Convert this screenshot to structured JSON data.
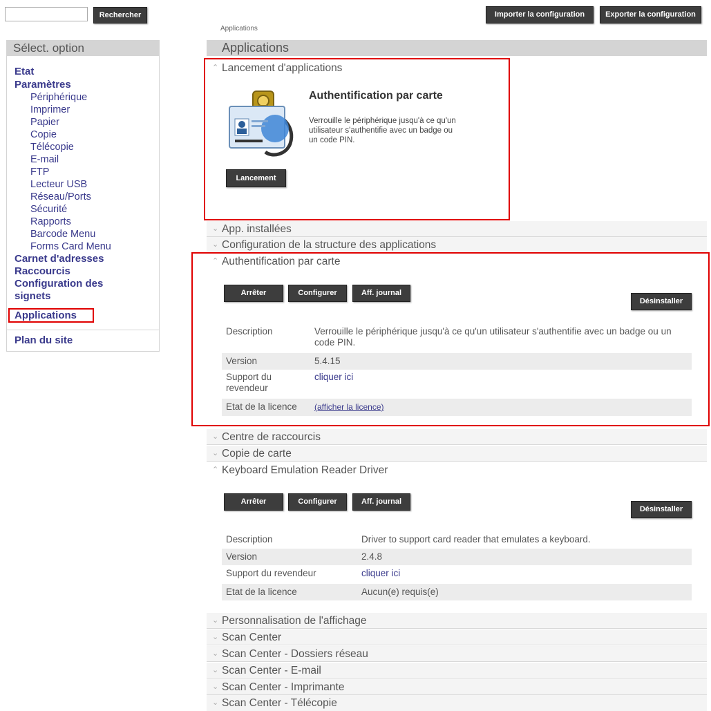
{
  "search": {
    "placeholder": "",
    "button_label": "Rechercher"
  },
  "left_nav": {
    "header": "Sélect. option",
    "etat": "Etat",
    "parametres": "Paramètres",
    "sub_items": [
      "Périphérique",
      "Imprimer",
      "Papier",
      "Copie",
      "Télécopie",
      "E-mail",
      "FTP",
      "Lecteur USB",
      "Réseau/Ports",
      "Sécurité",
      "Rapports",
      "Barcode Menu",
      "Forms Card Menu"
    ],
    "carnet": "Carnet d'adresses",
    "raccourcis": "Raccourcis",
    "config_signets_1": "Configuration des",
    "config_signets_2": "signets",
    "applications": "Applications",
    "plan_du_site": "Plan du site"
  },
  "toolbar": {
    "import_label": "Importer la configuration",
    "export_label": "Exporter la configuration"
  },
  "breadcrumb": "Applications",
  "main": {
    "title": "Applications",
    "launch_section": {
      "label": "Lancement d'applications",
      "app_title": "Authentification par carte",
      "app_desc": "Verrouille le périphérique jusqu'à ce qu'un utilisateur s'authentifie avec un badge ou un code PIN.",
      "launch_button": "Lancement"
    },
    "installed_label": "App. installées",
    "framework_label": "Configuration de la structure des applications",
    "card_auth": {
      "label": "Authentification par carte",
      "stop": "Arrêter",
      "configure": "Configurer",
      "log": "Aff. journal",
      "uninstall": "Désinstaller",
      "desc_key": "Description",
      "desc_val": "Verrouille le périphérique jusqu'à ce qu'un utilisateur s'authentifie avec un badge ou un code PIN.",
      "version_key": "Version",
      "version_val": "5.4.15",
      "support_key": "Support du revendeur",
      "support_val": "cliquer ici",
      "license_key": "Etat de la licence",
      "license_val": "(afficher la licence)"
    },
    "shortcut_center": "Centre de raccourcis",
    "card_copy": "Copie de carte",
    "keyboard_driver": {
      "label": "Keyboard Emulation Reader Driver",
      "stop": "Arrêter",
      "configure": "Configurer",
      "log": "Aff. journal",
      "uninstall": "Désinstaller",
      "desc_key": "Description",
      "desc_val": "Driver to support card reader that emulates a keyboard.",
      "version_key": "Version",
      "version_val": "2.4.8",
      "support_key": "Support du revendeur",
      "support_val": "cliquer ici",
      "license_key": "Etat de la licence",
      "license_val": "Aucun(e) requis(e)"
    },
    "bottom_sections": [
      "Personnalisation de l'affichage",
      "Scan Center",
      "Scan Center - Dossiers réseau",
      "Scan Center - E-mail",
      "Scan Center - Imprimante",
      "Scan Center - Télécopie"
    ]
  },
  "icons": {
    "expanded": "chevron-up-icon",
    "collapsed": "chevron-down-icon",
    "app": "badge-card-icon"
  },
  "colors": {
    "highlight": "#e00000",
    "link": "#3a3a8c",
    "button": "#3d3d3d",
    "header_bg": "#d4d4d4"
  }
}
